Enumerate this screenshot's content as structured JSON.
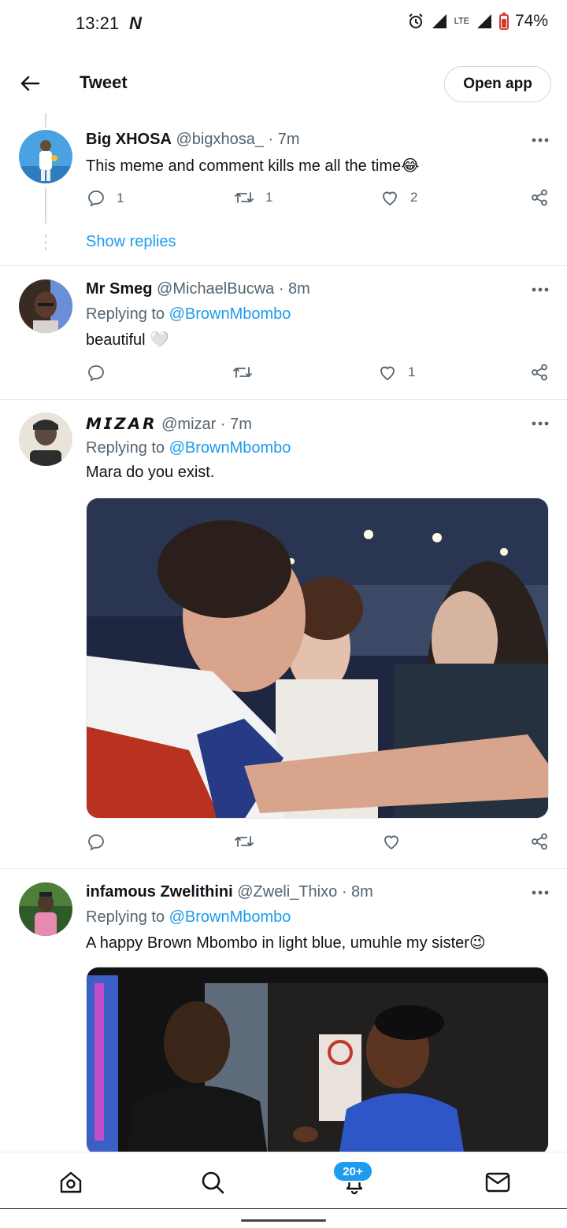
{
  "status_bar": {
    "time": "13:21",
    "nfc_icon": "N",
    "network": "LTE",
    "battery": "74%"
  },
  "header": {
    "title": "Tweet",
    "open_app": "Open app",
    "back_icon": "arrow-left-icon"
  },
  "tweets": [
    {
      "name": "Big XHOSA",
      "handle": "@bigxhosa_",
      "time": "· 7m",
      "text": "This meme and comment kills me all the time😂",
      "replies": "1",
      "retweets": "1",
      "likes": "2",
      "show_replies": "Show replies",
      "avatar_colors": [
        "#4aa3e0",
        "#e8c9a0",
        "#ffffff"
      ]
    },
    {
      "name": "Mr Smeg",
      "handle": "@MichaelBucwa",
      "time": "· 8m",
      "replying_prefix": "Replying to",
      "replying_to": "@BrownMbombo",
      "text": "beautiful 🤍",
      "replies": "",
      "retweets": "",
      "likes": "1",
      "avatar_colors": [
        "#3a2a24",
        "#6b8fd6",
        "#d9d3cf"
      ]
    },
    {
      "name": "𝙈𝙄𝙕𝘼𝙍",
      "handle": "@mizar",
      "time": "· 7m",
      "replying_prefix": "Replying to",
      "replying_to": "@BrownMbombo",
      "text": "Mara do you exist.",
      "replies": "",
      "retweets": "",
      "likes": "",
      "avatar_colors": [
        "#2d2d2d",
        "#e9e3d9",
        "#5b4b3e"
      ],
      "media_colors": [
        "#1f2740",
        "#c9c0b8",
        "#b8321f"
      ]
    },
    {
      "name": "infamous Zwelithini",
      "handle": "@Zweli_Thixo",
      "time": "· 8m",
      "replying_prefix": "Replying to",
      "replying_to": "@BrownMbombo",
      "text": "A happy Brown Mbombo in light blue, umuhle my sister😉",
      "avatar_colors": [
        "#2e5b2a",
        "#e88ab0",
        "#4b3a2b"
      ],
      "media_colors": [
        "#121212",
        "#3b5fc4",
        "#7a4b2c"
      ]
    }
  ],
  "bottom_nav": {
    "home_icon": "home-icon",
    "search_icon": "search-icon",
    "notifications_icon": "bell-icon",
    "notifications_badge": "20+",
    "messages_icon": "mail-icon"
  },
  "colors": {
    "accent": "#1d9bf0",
    "secondary_text": "#536471",
    "divider": "#e6ecf0"
  }
}
